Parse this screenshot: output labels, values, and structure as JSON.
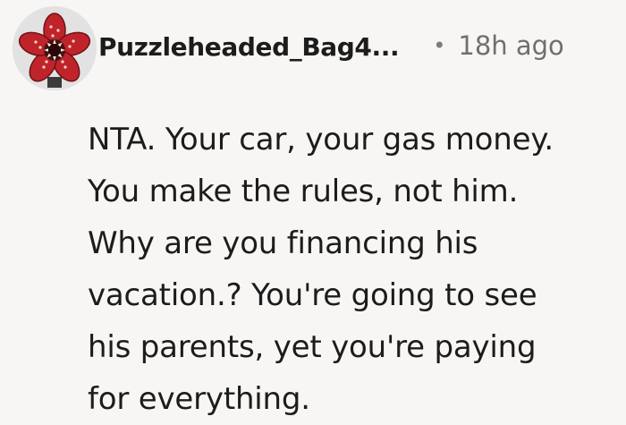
{
  "comment": {
    "author": "Puzzleheaded_Bag4...",
    "separator": "•",
    "timestamp": "18h ago",
    "avatar_icon": "demogorgon-avatar-icon",
    "body_lines": [
      "NTA. Your car, your gas money.",
      "You make the rules, not him.",
      "Why are you financing his",
      "vacation.? You're going to see",
      "his parents, yet you're paying",
      "for everything."
    ]
  },
  "colors": {
    "background": "#f8f6f4",
    "text": "#1c1c1c",
    "muted": "#6f6f6f",
    "avatar_petal": "#c0242b",
    "avatar_background": "#e2e2e2"
  }
}
